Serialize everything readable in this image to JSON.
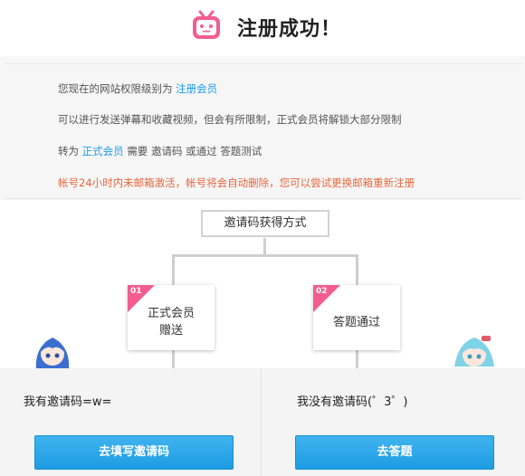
{
  "header": {
    "title": "注册成功！",
    "logo_icon": "bilibili-tv-icon",
    "logo_color": "#f25d8e"
  },
  "info": {
    "l1_text": "您现在的网站权限级别为",
    "l1_link": "注册会员",
    "l2_text": "可以进行发送弹幕和收藏视频，但会有所限制，正式会员将解锁大部分限制",
    "l3_a": "转为",
    "l3_link": "正式会员",
    "l3_b": "需要",
    "l3_c": "邀请码",
    "l3_d": "或通过",
    "l3_e": "答题测试",
    "l4_text": "帐号24小时内未邮箱激活，帐号将会自动删除，您可以尝试更换邮箱重新注册",
    "accent_blue": "#1e9de6",
    "warning_color": "#e8663d"
  },
  "diagram": {
    "method_title": "邀请码获得方式",
    "card1_num": "01",
    "card1_line1": "正式会员",
    "card1_line2": "赠送",
    "card2_num": "02",
    "card2_text": "答题通过",
    "badge_color": "#f25d8e"
  },
  "left_panel": {
    "label": "我有邀请码=w=",
    "button": "去填写邀请码"
  },
  "right_panel": {
    "label": "我没有邀请码(゜3゜)",
    "button": "去答题"
  }
}
